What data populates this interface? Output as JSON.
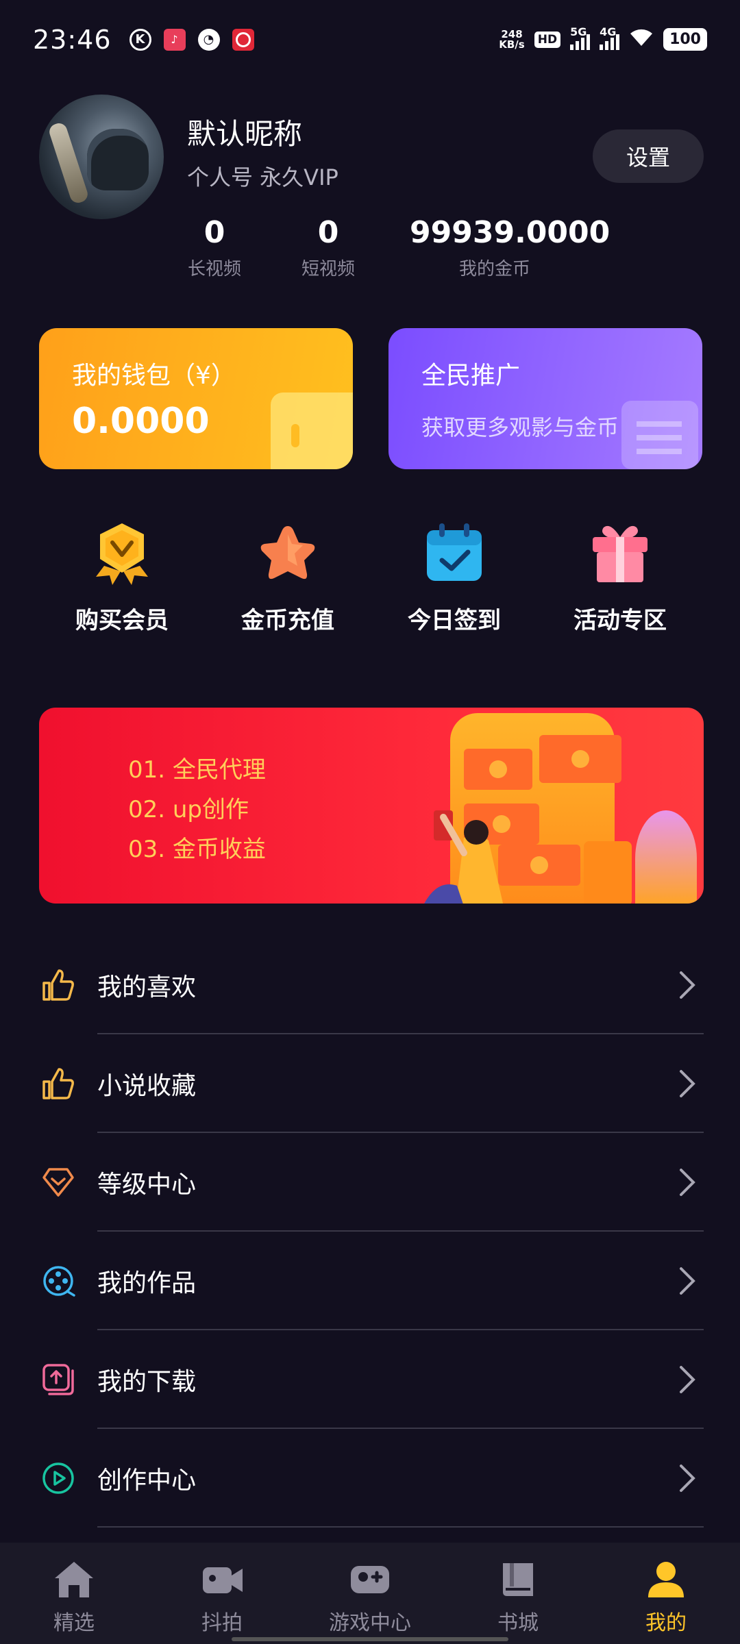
{
  "status_bar": {
    "time": "23:46",
    "net_speed_value": "248",
    "net_speed_unit": "KB/s",
    "hd": "HD",
    "signal_1": "5G",
    "signal_2": "4G",
    "battery": "100",
    "app_k": "K",
    "app_tiktok": "♪"
  },
  "profile": {
    "nickname": "默认昵称",
    "subtitle": "个人号 永久VIP",
    "settings_label": "设置",
    "stats": [
      {
        "value": "0",
        "label": "长视频"
      },
      {
        "value": "0",
        "label": "短视频"
      },
      {
        "value": "99939.0000",
        "label": "我的金币"
      }
    ]
  },
  "cards": {
    "wallet": {
      "title": "我的钱包（¥）",
      "value": "0.0000",
      "color": "#ffa01a"
    },
    "promo": {
      "title": "全民推广",
      "desc": "获取更多观影与金币",
      "color": "#7b4dff"
    }
  },
  "quick_actions": [
    {
      "label": "购买会员",
      "icon": "medal-icon"
    },
    {
      "label": "金币充值",
      "icon": "star-icon"
    },
    {
      "label": "今日签到",
      "icon": "calendar-check-icon"
    },
    {
      "label": "活动专区",
      "icon": "gift-icon"
    }
  ],
  "banner": {
    "lines": [
      "01. 全民代理",
      "02. up创作",
      "03. 金币收益"
    ]
  },
  "menu": [
    {
      "label": "我的喜欢",
      "icon": "thumb-up-icon",
      "color": "#f5b94a"
    },
    {
      "label": "小说收藏",
      "icon": "thumb-up-icon",
      "color": "#f5b94a"
    },
    {
      "label": "等级中心",
      "icon": "diamond-icon",
      "color": "#f08a4b"
    },
    {
      "label": "我的作品",
      "icon": "film-reel-icon",
      "color": "#3fb6f0"
    },
    {
      "label": "我的下载",
      "icon": "upload-box-icon",
      "color": "#f06a9a"
    },
    {
      "label": "创作中心",
      "icon": "play-circle-icon",
      "color": "#18c4a0"
    }
  ],
  "bottom_nav": [
    {
      "label": "精选",
      "icon": "home-icon"
    },
    {
      "label": "抖拍",
      "icon": "video-camera-icon"
    },
    {
      "label": "游戏中心",
      "icon": "gamepad-icon"
    },
    {
      "label": "书城",
      "icon": "book-icon"
    },
    {
      "label": "我的",
      "icon": "user-icon",
      "active": true
    }
  ],
  "accent_color": "#ffc629",
  "background_color": "#120f1f"
}
